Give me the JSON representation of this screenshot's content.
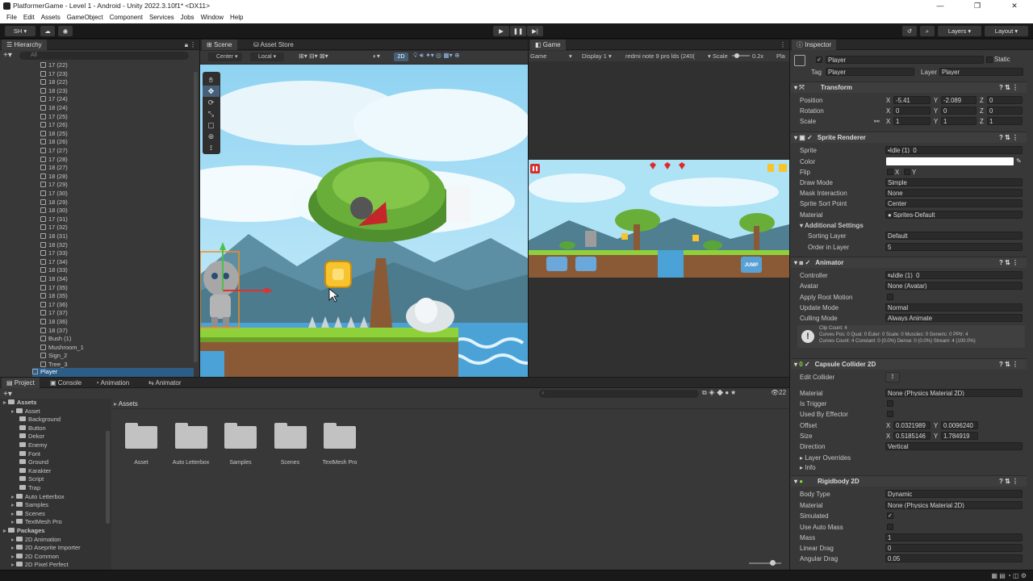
{
  "window": {
    "title": "PlatformerGame - Level 1 - Android - Unity 2022.3.10f1* <DX11>",
    "controls": [
      "—",
      "❐",
      "✕"
    ]
  },
  "menu": [
    "File",
    "Edit",
    "Assets",
    "GameObject",
    "Component",
    "Services",
    "Jobs",
    "Window",
    "Help"
  ],
  "toolbar": {
    "account": "SH ▾",
    "layers": "Layers",
    "layout": "Layout"
  },
  "hierarchy": {
    "tab": "Hierarchy",
    "search_placeholder": "All",
    "items": [
      "17 (22)",
      "17 (23)",
      "18 (22)",
      "18 (23)",
      "17 (24)",
      "18 (24)",
      "17 (25)",
      "17 (26)",
      "18 (25)",
      "18 (26)",
      "17 (27)",
      "17 (28)",
      "18 (27)",
      "18 (28)",
      "17 (29)",
      "17 (30)",
      "18 (29)",
      "18 (30)",
      "17 (31)",
      "17 (32)",
      "18 (31)",
      "18 (32)",
      "17 (33)",
      "17 (34)",
      "18 (33)",
      "18 (34)",
      "17 (35)",
      "18 (35)",
      "17 (36)",
      "17 (37)",
      "18 (36)",
      "18 (37)",
      "Bush (1)",
      "Mushroom_1",
      "Sign_2",
      "Tree_3"
    ],
    "selected": "Player"
  },
  "scene": {
    "tabs": [
      "Scene",
      "Asset Store"
    ],
    "pivot": "Center",
    "space": "Local",
    "mode_2d": "2D"
  },
  "game": {
    "tab": "Game",
    "display_mode": "Game",
    "display": "Display 1",
    "resolution": "redmi note 9 pro lds (240(",
    "scale_label": "Scale",
    "scale_value": "0.2x",
    "play_label": "Pla",
    "jump_label": "JUMP"
  },
  "project": {
    "tabs": [
      "Project",
      "Console",
      "Animation",
      "Animator"
    ],
    "breadcrumb": "Assets",
    "count": "22",
    "tree": [
      {
        "label": "Assets",
        "indent": 0,
        "bold": true
      },
      {
        "label": "Asset",
        "indent": 1
      },
      {
        "label": "Background",
        "indent": 2
      },
      {
        "label": "Button",
        "indent": 2
      },
      {
        "label": "Dekor",
        "indent": 2
      },
      {
        "label": "Enemy",
        "indent": 2
      },
      {
        "label": "Font",
        "indent": 2
      },
      {
        "label": "Ground",
        "indent": 2
      },
      {
        "label": "Karakter",
        "indent": 2
      },
      {
        "label": "Script",
        "indent": 2
      },
      {
        "label": "Trap",
        "indent": 2
      },
      {
        "label": "Auto Letterbox",
        "indent": 1
      },
      {
        "label": "Samples",
        "indent": 1
      },
      {
        "label": "Scenes",
        "indent": 1
      },
      {
        "label": "TextMesh Pro",
        "indent": 1
      },
      {
        "label": "Packages",
        "indent": 0,
        "bold": true
      },
      {
        "label": "2D Animation",
        "indent": 1
      },
      {
        "label": "2D Aseprite Importer",
        "indent": 1
      },
      {
        "label": "2D Common",
        "indent": 1
      },
      {
        "label": "2D Pixel Perfect",
        "indent": 1
      }
    ],
    "grid_items": [
      "Asset",
      "Auto Letterbox",
      "Samples",
      "Scenes",
      "TextMesh Pro"
    ]
  },
  "inspector": {
    "tab": "Inspector",
    "object_name": "Player",
    "static_label": "Static",
    "tag_label": "Tag",
    "tag_value": "Player",
    "layer_label": "Layer",
    "layer_value": "Player",
    "transform": {
      "title": "Transform",
      "position_label": "Position",
      "pos_x": "-5.41",
      "pos_y": "-2.089",
      "pos_z": "0",
      "rotation_label": "Rotation",
      "rot_x": "0",
      "rot_y": "0",
      "rot_z": "0",
      "scale_label": "Scale",
      "scl_x": "1",
      "scl_y": "1",
      "scl_z": "1"
    },
    "sprite_renderer": {
      "title": "Sprite Renderer",
      "sprite_label": "Sprite",
      "sprite_value": "Idle (1)_0",
      "color_label": "Color",
      "flip_label": "Flip",
      "draw_mode_label": "Draw Mode",
      "draw_mode_value": "Simple",
      "mask_label": "Mask Interaction",
      "mask_value": "None",
      "sort_point_label": "Sprite Sort Point",
      "sort_point_value": "Center",
      "material_label": "Material",
      "material_value": "Sprites-Default",
      "additional_label": "Additional Settings",
      "sorting_layer_label": "Sorting Layer",
      "sorting_layer_value": "Default",
      "order_label": "Order in Layer",
      "order_value": "5"
    },
    "animator": {
      "title": "Animator",
      "controller_label": "Controller",
      "controller_value": "Idle (1)_0",
      "avatar_label": "Avatar",
      "avatar_value": "None (Avatar)",
      "root_motion_label": "Apply Root Motion",
      "update_mode_label": "Update Mode",
      "update_mode_value": "Normal",
      "culling_label": "Culling Mode",
      "culling_value": "Always Animate",
      "info_lines": [
        "Clip Count: 4",
        "Curves Pos: 0 Quat: 0 Euler: 0 Scale: 0 Muscles: 0 Generic: 0 PPtr: 4",
        "Curves Count: 4 Constant: 0 (0.0%) Dense: 0 (0.0%) Stream: 4 (100.0%)"
      ]
    },
    "capsule": {
      "title": "Capsule Collider 2D",
      "edit_label": "Edit Collider",
      "material_label": "Material",
      "material_value": "None (Physics Material 2D)",
      "trigger_label": "Is Trigger",
      "effector_label": "Used By Effector",
      "offset_label": "Offset",
      "offset_x": "0.0321989",
      "offset_y": "0.0096240",
      "size_label": "Size",
      "size_x": "0.5185146",
      "size_y": "1.784919",
      "direction_label": "Direction",
      "direction_value": "Vertical",
      "layer_overrides_label": "Layer Overrides",
      "info_label": "Info"
    },
    "rigidbody": {
      "title": "Rigidbody 2D",
      "body_type_label": "Body Type",
      "body_type_value": "Dynamic",
      "material_label": "Material",
      "material_value": "None (Physics Material 2D)",
      "simulated_label": "Simulated",
      "auto_mass_label": "Use Auto Mass",
      "mass_label": "Mass",
      "mass_value": "1",
      "linear_drag_label": "Linear Drag",
      "linear_drag_value": "0",
      "angular_drag_label": "Angular Drag",
      "angular_drag_value": "0.05"
    }
  }
}
